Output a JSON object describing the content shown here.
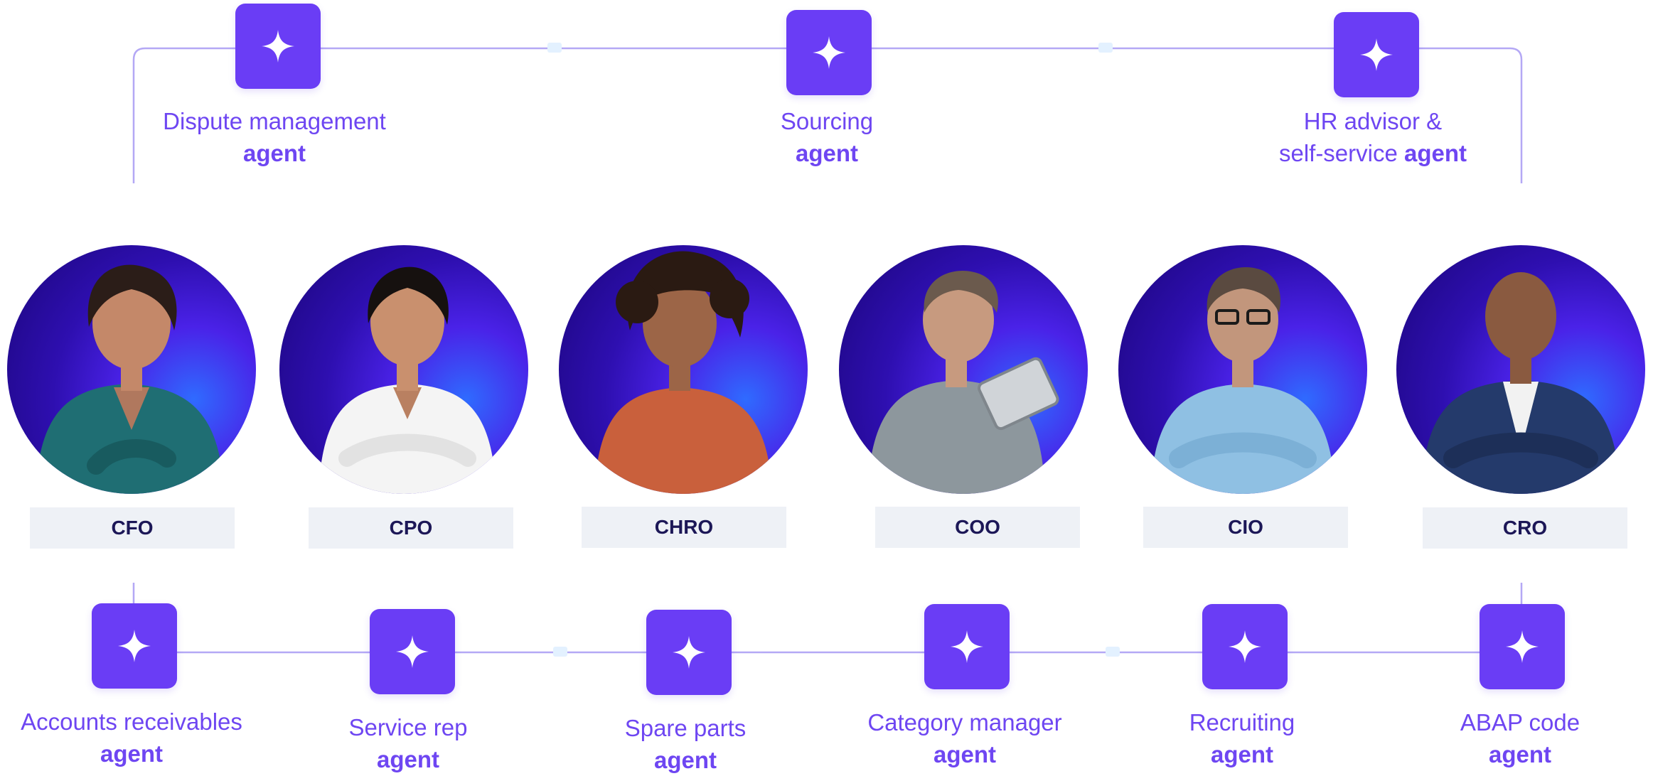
{
  "colors": {
    "tile": "#6a3df5",
    "agent_text": "#6e46f2",
    "connector": "#b4a8f5",
    "badge_bg": "#eef1f6",
    "badge_text": "#1c1757",
    "circle_dark": "#1a0578",
    "circle_light": "#2f6bff"
  },
  "top_agents": [
    {
      "line1": "Dispute management",
      "line2_plain": "",
      "line2_bold": "agent",
      "icon": "sparkle-icon"
    },
    {
      "line1": "Sourcing",
      "line2_plain": "",
      "line2_bold": "agent",
      "icon": "sparkle-icon"
    },
    {
      "line1": "HR advisor &",
      "line2_plain": "self-service ",
      "line2_bold": "agent",
      "icon": "sparkle-icon"
    }
  ],
  "executives": [
    {
      "title": "CFO",
      "shirt": "#1f6e73"
    },
    {
      "title": "CPO",
      "shirt": "#f4f4f4"
    },
    {
      "title": "CHRO",
      "shirt": "#c9603c"
    },
    {
      "title": "COO",
      "shirt": "#8d979d"
    },
    {
      "title": "CIO",
      "shirt": "#8fc0e3"
    },
    {
      "title": "CRO",
      "shirt": "#243a6b"
    }
  ],
  "bottom_agents": [
    {
      "line1": "Accounts receivables",
      "line2_bold": "agent",
      "icon": "sparkle-icon"
    },
    {
      "line1": "Service rep",
      "line2_bold": "agent",
      "icon": "sparkle-icon"
    },
    {
      "line1": "Spare parts",
      "line2_bold": "agent",
      "icon": "sparkle-icon"
    },
    {
      "line1": "Category manager",
      "line2_bold": "agent",
      "icon": "sparkle-icon"
    },
    {
      "line1": "Recruiting",
      "line2_bold": "agent",
      "icon": "sparkle-icon"
    },
    {
      "line1": "ABAP code",
      "line2_bold": "agent",
      "icon": "sparkle-icon"
    }
  ]
}
